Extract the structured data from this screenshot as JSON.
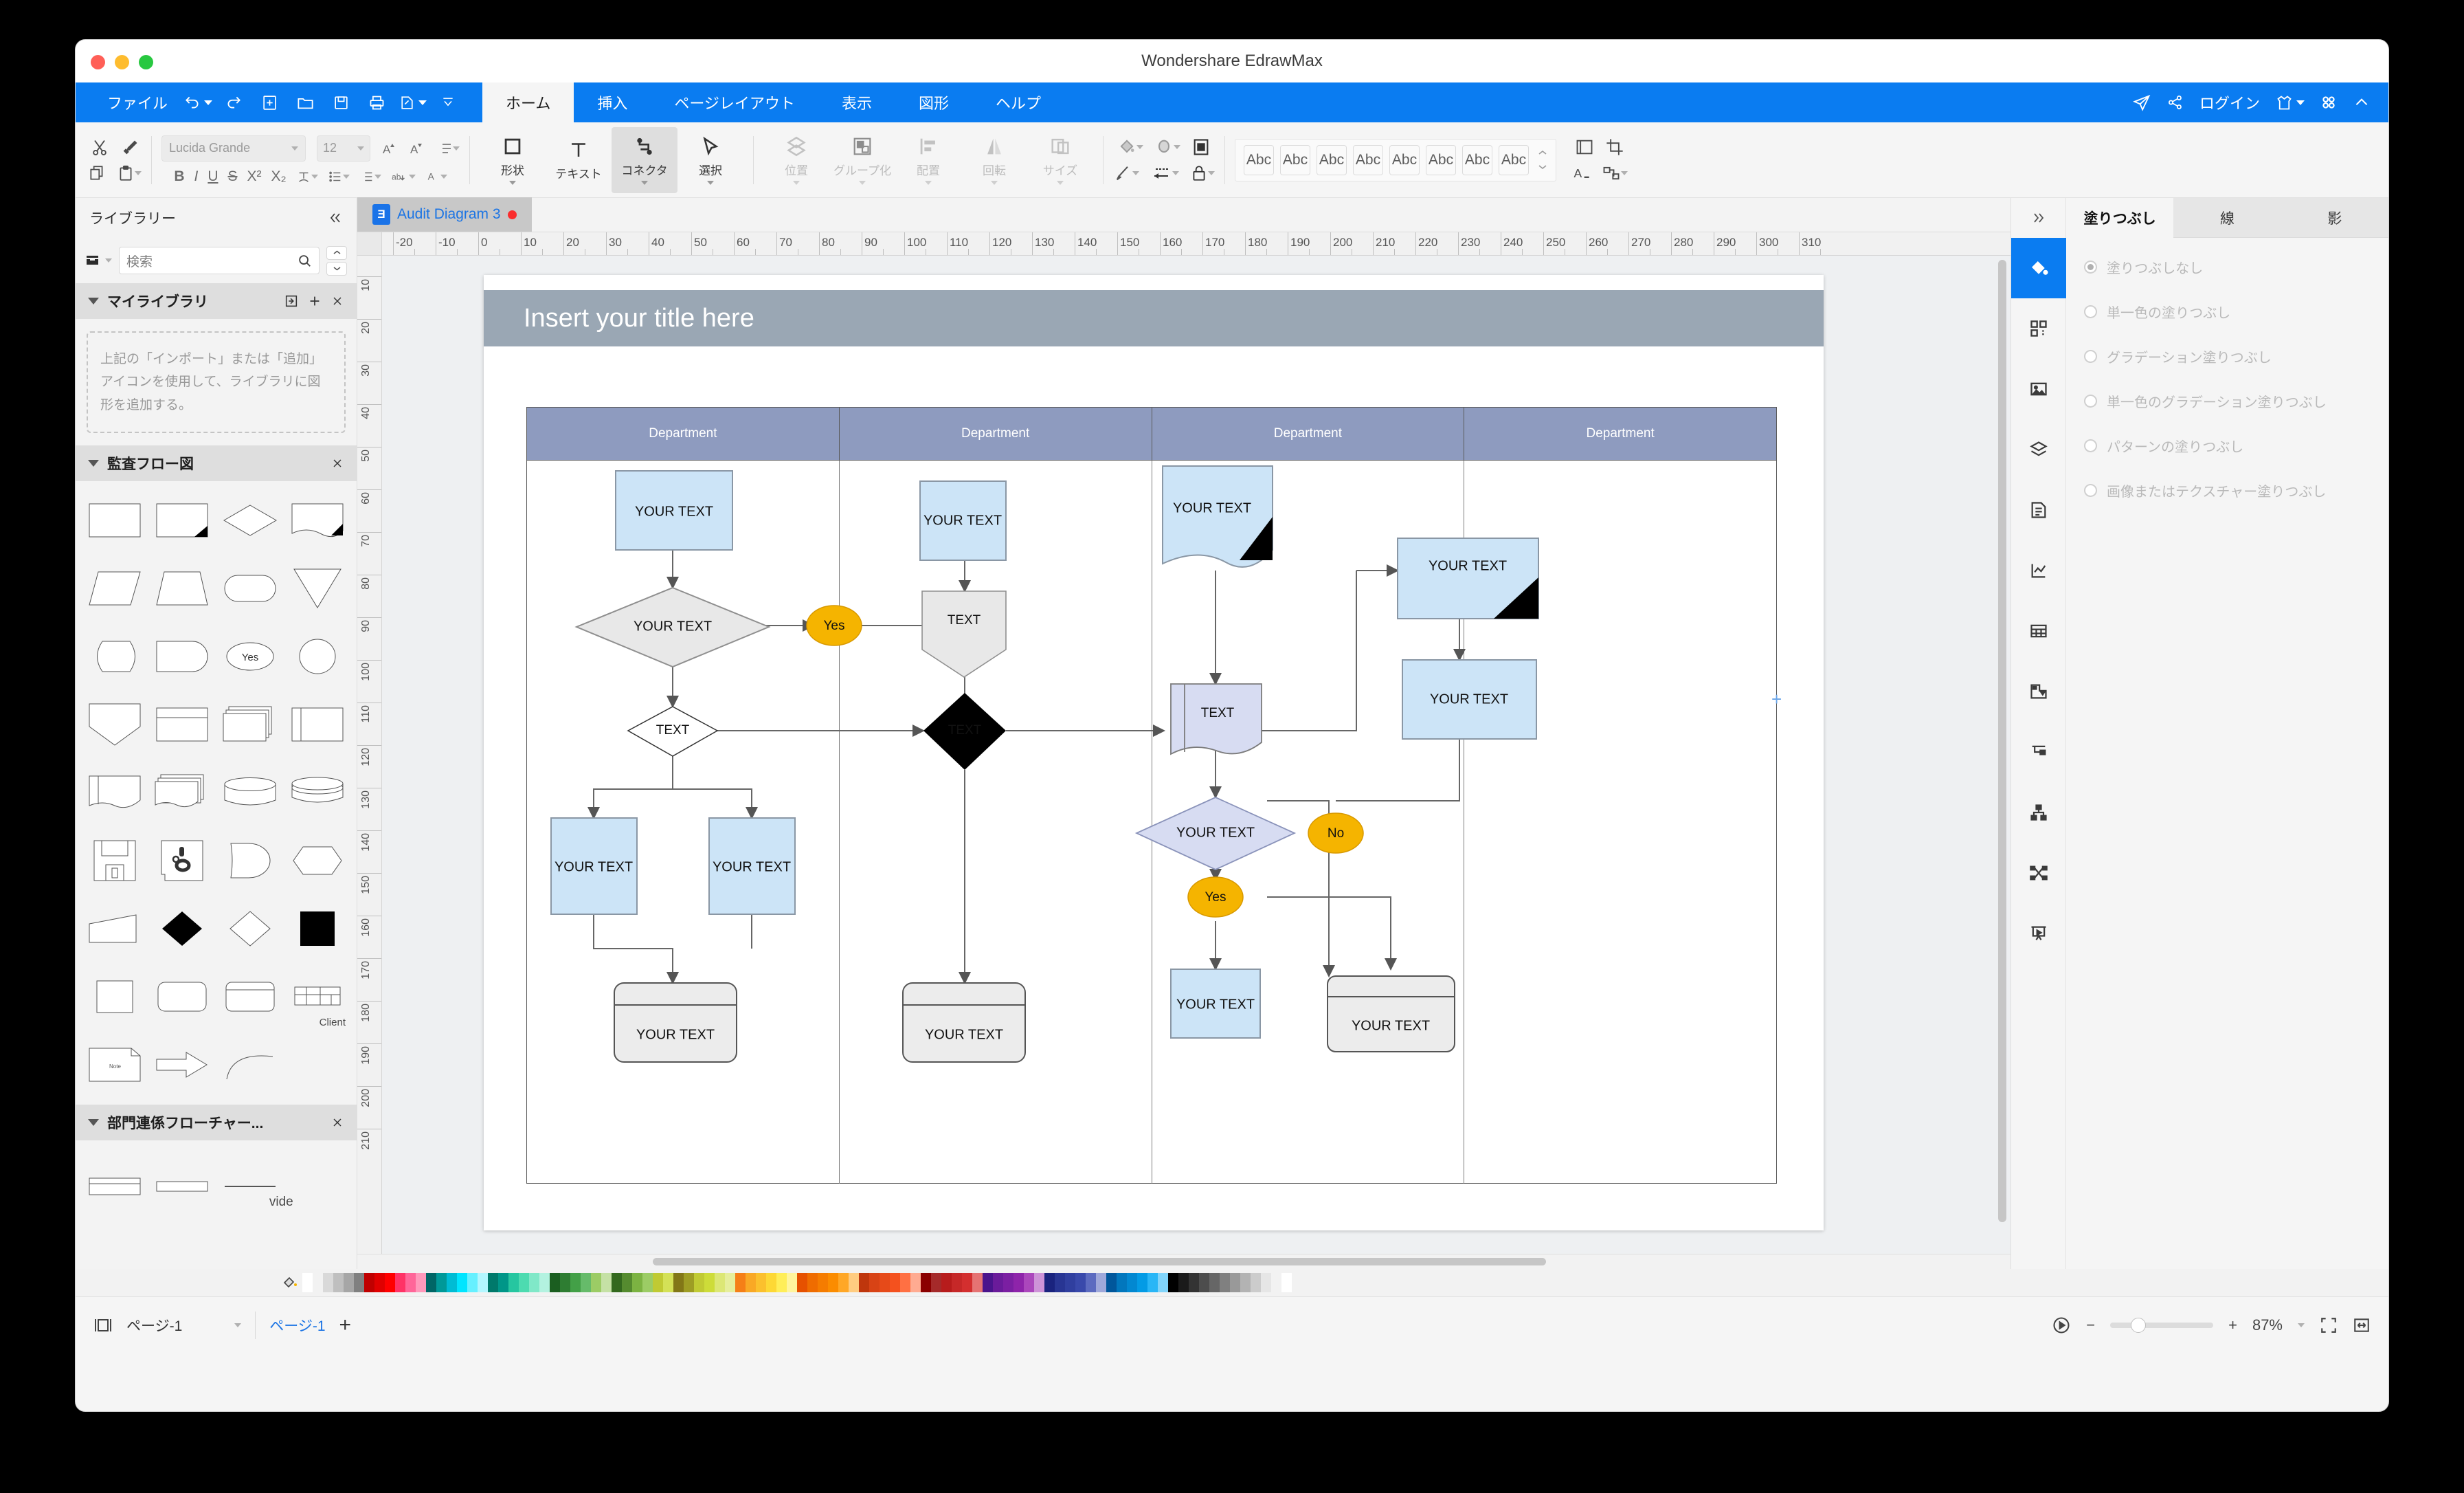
{
  "window": {
    "title": "Wondershare EdrawMax"
  },
  "menubar": {
    "file_label": "ファイル",
    "quick_icons": [
      "undo-icon",
      "redo-icon",
      "new-icon",
      "open-icon",
      "save-icon",
      "print-icon",
      "export-icon",
      "more-icon"
    ],
    "tabs": [
      {
        "label": "ホーム",
        "active": true
      },
      {
        "label": "挿入",
        "active": false
      },
      {
        "label": "ページレイアウト",
        "active": false
      },
      {
        "label": "表示",
        "active": false
      },
      {
        "label": "図形",
        "active": false
      },
      {
        "label": "ヘルプ",
        "active": false
      }
    ],
    "right": {
      "login_label": "ログイン"
    }
  },
  "ribbon": {
    "font_family": "Lucida Grande",
    "font_size": "12",
    "tools": [
      {
        "label": "形状",
        "icon": "square-icon",
        "selected": false,
        "disabled": false
      },
      {
        "label": "テキスト",
        "icon": "text-icon",
        "selected": false,
        "disabled": false
      },
      {
        "label": "コネクタ",
        "icon": "connector-icon",
        "selected": true,
        "disabled": false
      },
      {
        "label": "選択",
        "icon": "cursor-icon",
        "selected": false,
        "disabled": false
      }
    ],
    "arrange": [
      {
        "label": "位置",
        "icon": "position-icon",
        "disabled": true
      },
      {
        "label": "グループ化",
        "icon": "group-icon",
        "disabled": true
      },
      {
        "label": "配置",
        "icon": "align-icon",
        "disabled": true
      },
      {
        "label": "回転",
        "icon": "rotate-icon",
        "disabled": true
      },
      {
        "label": "サイズ",
        "icon": "size-icon",
        "disabled": true
      }
    ],
    "style_swatch_label": "Abc",
    "style_swatch_count": 8
  },
  "library": {
    "title": "ライブラリー",
    "collapse_icon": "chevron-double-left-icon",
    "search_placeholder": "検索",
    "my_library": {
      "title": "マイライブラリ",
      "hint": "上記の「インポート」または「追加」アイコンを使用して、ライブラリに図形を追加する。"
    },
    "sections": [
      {
        "title": "監査フロー図",
        "shape_caption": "Client"
      },
      {
        "title": "部門連係フローチャー...",
        "shape_caption": "vide"
      }
    ]
  },
  "document": {
    "tab_label": "Audit Diagram 3",
    "modified": true,
    "h_ruler_labels": [
      "-20",
      "-10",
      "0",
      "10",
      "20",
      "30",
      "40",
      "50",
      "60",
      "70",
      "80",
      "90",
      "100",
      "110",
      "120",
      "130",
      "140",
      "150",
      "160",
      "170",
      "180",
      "190",
      "200",
      "210",
      "220",
      "230",
      "240",
      "250",
      "260",
      "270",
      "280",
      "290",
      "300",
      "310"
    ],
    "v_ruler_labels": [
      "10",
      "20",
      "30",
      "40",
      "50",
      "60",
      "70",
      "80",
      "90",
      "100",
      "110",
      "120",
      "130",
      "140",
      "150",
      "160",
      "170",
      "180",
      "190",
      "200",
      "210"
    ]
  },
  "diagram": {
    "title": "Insert your title here",
    "lanes": [
      "Department",
      "Department",
      "Department",
      "Department"
    ],
    "nodes": [
      {
        "id": "n1",
        "label": "YOUR TEXT",
        "shape": "rect",
        "lane": 1
      },
      {
        "id": "n2",
        "label": "YOUR TEXT",
        "shape": "diamond",
        "lane": 1
      },
      {
        "id": "n3",
        "label": "TEXT",
        "shape": "small-diamond",
        "lane": 1
      },
      {
        "id": "n4",
        "label": "YOUR TEXT",
        "shape": "rect",
        "lane": 1
      },
      {
        "id": "n5",
        "label": "YOUR TEXT",
        "shape": "rect",
        "lane": 1
      },
      {
        "id": "n6",
        "label": "YOUR TEXT",
        "shape": "rounded-card",
        "lane": 1
      },
      {
        "id": "n7",
        "label": "YOUR TEXT",
        "shape": "rect",
        "lane": 2
      },
      {
        "id": "n8",
        "label": "TEXT",
        "shape": "pentagon-down",
        "lane": 2
      },
      {
        "id": "n9",
        "label": "TEXT",
        "shape": "black-diamond",
        "lane": 2
      },
      {
        "id": "n10",
        "label": "YOUR TEXT",
        "shape": "rounded-card",
        "lane": 2
      },
      {
        "id": "n11",
        "label": "YOUR TEXT",
        "shape": "document-corner",
        "lane": 3
      },
      {
        "id": "n12",
        "label": "TEXT",
        "shape": "wave-doc",
        "lane": 3
      },
      {
        "id": "n13",
        "label": "YOUR TEXT",
        "shape": "diamond",
        "lane": 3
      },
      {
        "id": "n14",
        "label": "YOUR TEXT",
        "shape": "rect",
        "lane": 3
      },
      {
        "id": "n15",
        "label": "YOUR TEXT",
        "shape": "corner-rect",
        "lane": 4
      },
      {
        "id": "n16",
        "label": "YOUR TEXT",
        "shape": "rect",
        "lane": 4
      },
      {
        "id": "n17",
        "label": "YOUR TEXT",
        "shape": "rounded-card",
        "lane": 4
      }
    ],
    "decisions": [
      {
        "id": "d1",
        "label": "Yes"
      },
      {
        "id": "d2",
        "label": "Yes"
      },
      {
        "id": "d3",
        "label": "No"
      }
    ],
    "colors": {
      "title_band": "#9aa7b4",
      "lane_header": "#8e9bbf",
      "node_blue": "#cce4f7",
      "node_lavender": "#d7dcf2",
      "node_grey": "#e8e8e8",
      "decision_yellow": "#f5b400"
    }
  },
  "right_panel": {
    "collapse_icon": "chevron-double-right-icon",
    "tabs": [
      {
        "label": "塗りつぶし",
        "active": true
      },
      {
        "label": "線",
        "active": false
      },
      {
        "label": "影",
        "active": false
      }
    ],
    "fill_options": [
      {
        "label": "塗りつぶしなし",
        "selected": true
      },
      {
        "label": "単一色の塗りつぶし",
        "selected": false
      },
      {
        "label": "グラデーション塗りつぶし",
        "selected": false
      },
      {
        "label": "単一色のグラデーション塗りつぶし",
        "selected": false
      },
      {
        "label": "パターンの塗りつぶし",
        "selected": false
      },
      {
        "label": "画像またはテクスチャー塗りつぶし",
        "selected": false
      }
    ],
    "tool_icons": [
      "fill-bucket-icon",
      "shapes-icon",
      "image-icon",
      "layers-icon",
      "page-list-icon",
      "chart-icon",
      "table-icon",
      "floorplan-icon",
      "mindmap-icon",
      "orgchart-icon",
      "network-icon",
      "present-icon"
    ]
  },
  "statusbar": {
    "page_select": "ページ-1",
    "page_tab": "ページ-1",
    "add_page_label": "+",
    "zoom_level": "87%",
    "zoom_out": "−",
    "zoom_in": "+"
  }
}
